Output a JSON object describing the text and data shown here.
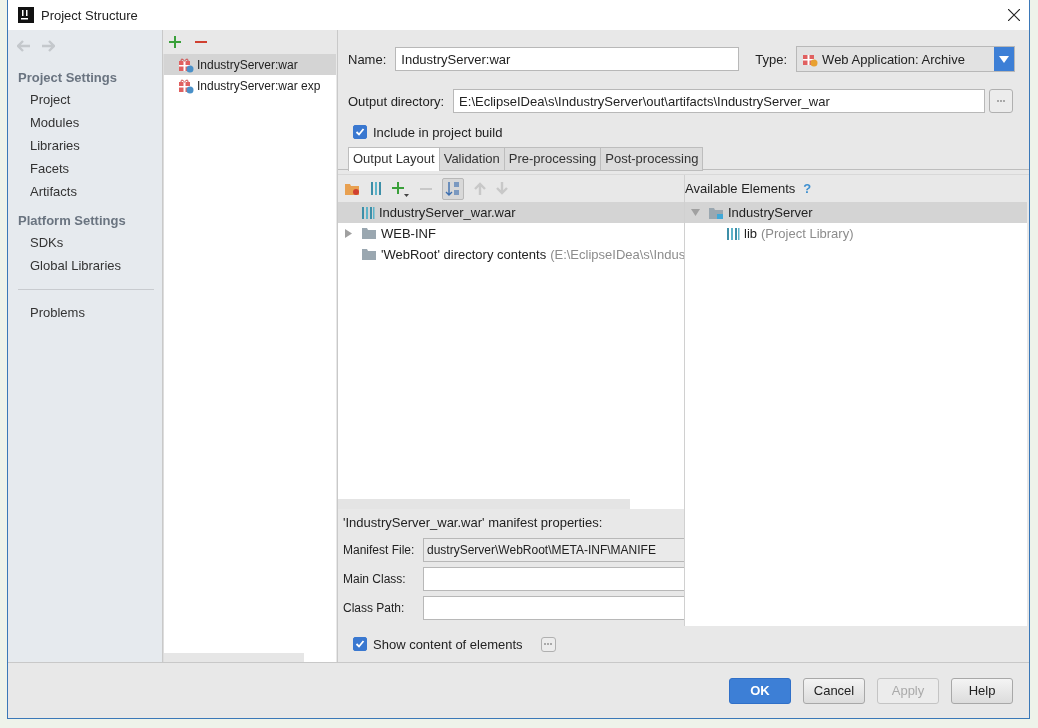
{
  "window": {
    "title": "Project Structure"
  },
  "sidebar": {
    "sections": [
      {
        "heading": "Project Settings",
        "items": [
          {
            "label": "Project",
            "selected": false
          },
          {
            "label": "Modules",
            "selected": false
          },
          {
            "label": "Libraries",
            "selected": false
          },
          {
            "label": "Facets",
            "selected": false
          },
          {
            "label": "Artifacts",
            "selected": false
          }
        ]
      },
      {
        "heading": "Platform Settings",
        "items": [
          {
            "label": "SDKs",
            "selected": false
          },
          {
            "label": "Global Libraries",
            "selected": false
          }
        ]
      }
    ],
    "extra_items": [
      {
        "label": "Problems",
        "selected": false
      }
    ]
  },
  "artifacts": [
    {
      "label": "IndustryServer:war",
      "selected": true
    },
    {
      "label": "IndustryServer:war exp",
      "selected": false
    }
  ],
  "name": {
    "label": "Name:",
    "value": "IndustryServer:war"
  },
  "type": {
    "label": "Type:",
    "value": "Web Application: Archive"
  },
  "output_directory": {
    "label": "Output directory:",
    "value": "E:\\EclipseIDea\\s\\IndustryServer\\out\\artifacts\\IndustryServer_war"
  },
  "include_in_build": {
    "label": "Include in project build",
    "checked": true
  },
  "tabs": [
    {
      "label": "Output Layout",
      "selected": true
    },
    {
      "label": "Validation",
      "selected": false
    },
    {
      "label": "Pre-processing",
      "selected": false
    },
    {
      "label": "Post-processing",
      "selected": false
    }
  ],
  "layout_tree": [
    {
      "label": "IndustryServer_war.war",
      "kind": "archive",
      "selected": true,
      "children": [
        {
          "label": "WEB-INF",
          "kind": "folder",
          "selected": false
        },
        {
          "label": "'WebRoot' directory contents",
          "detail": "(E:\\EclipseIDea\\s\\Indus",
          "kind": "dircontents",
          "selected": false
        }
      ]
    }
  ],
  "available": {
    "heading": "Available Elements",
    "help": "?",
    "tree": [
      {
        "label": "IndustryServer",
        "kind": "module",
        "selected": true,
        "children": [
          {
            "label": "lib",
            "detail": "(Project Library)",
            "kind": "library",
            "selected": false
          }
        ]
      }
    ]
  },
  "manifest": {
    "title": "'IndustryServer_war.war' manifest properties:",
    "fields": [
      {
        "label": "Manifest File:",
        "value": "dustryServer\\WebRoot\\META-INF\\MANIFE",
        "disabled": true
      },
      {
        "label": "Main Class:",
        "disabled": false
      },
      {
        "label": "Class Path:",
        "disabled": false
      }
    ]
  },
  "show_content": {
    "label": "Show content of elements",
    "checked": true
  },
  "buttons": [
    {
      "label": "OK",
      "kind": "primary",
      "disabled": false
    },
    {
      "label": "Cancel",
      "kind": "normal",
      "disabled": false
    },
    {
      "label": "Apply",
      "kind": "normal",
      "disabled": true
    },
    {
      "label": "Help",
      "kind": "normal",
      "disabled": false
    }
  ]
}
